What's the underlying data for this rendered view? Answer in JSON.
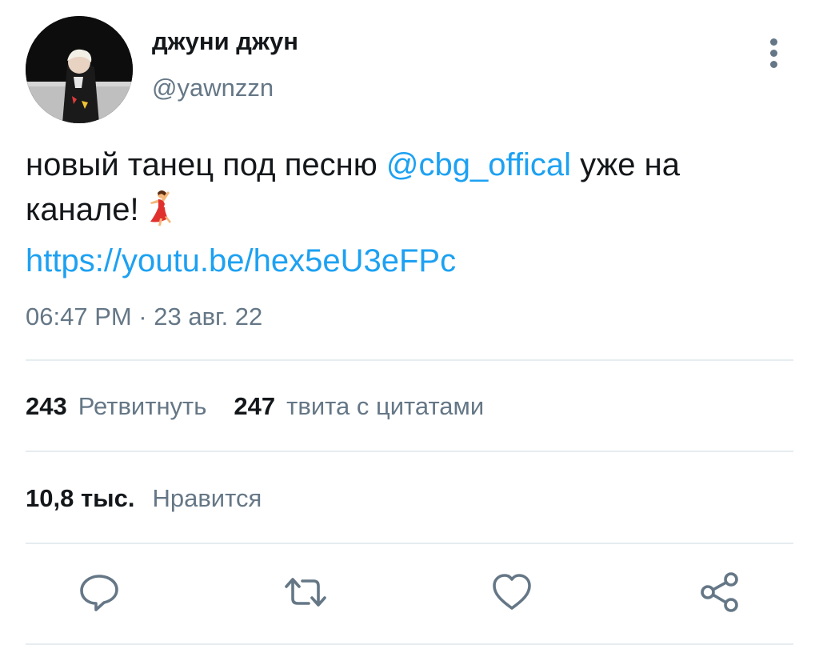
{
  "tweet": {
    "author": {
      "display_name": "джуни джун",
      "handle": "@yawnzzn"
    },
    "text": {
      "part1": "новый танец под песню ",
      "mention": "@cbg_offical",
      "part2": " уже на канале!",
      "emoji": "dancer-emoji",
      "link": "https://youtu.be/hex5eU3eFPc"
    },
    "timestamp": "06:47 PM · 23 авг. 22"
  },
  "stats": {
    "retweets_count": "243",
    "retweets_label": "Ретвитнуть",
    "quotes_count": "247",
    "quotes_label": "твита с цитатами",
    "likes_count": "10,8 тыс.",
    "likes_label": "Нравится"
  },
  "actions": {
    "reply_icon": "speech-bubble-icon",
    "retweet_icon": "retweet-arrows-icon",
    "like_icon": "heart-outline-icon",
    "share_icon": "share-nodes-icon"
  },
  "colors": {
    "link": "#1da1f2",
    "secondary_text": "#657786",
    "primary_text": "#14171a",
    "divider": "#e6ecf0"
  }
}
